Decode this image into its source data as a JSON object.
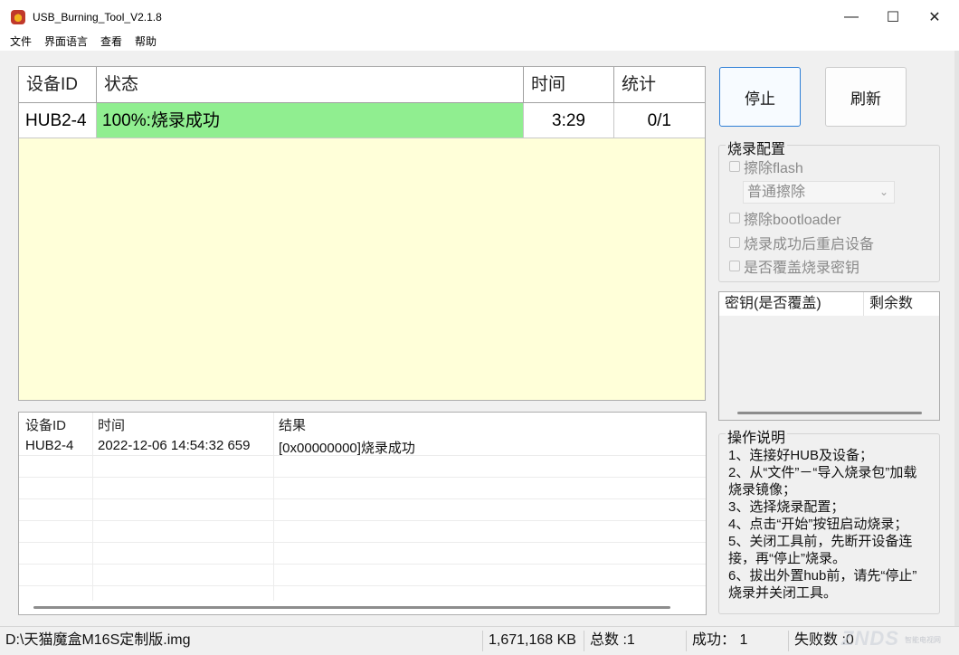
{
  "window": {
    "title": "USB_Burning_Tool_V2.1.8",
    "minimize_glyph": "—",
    "maximize_glyph": "☐",
    "close_glyph": "✕"
  },
  "menu": [
    "文件",
    "界面语言",
    "查看",
    "帮助"
  ],
  "device_table": {
    "headers": [
      "设备ID",
      "状态",
      "时间",
      "统计"
    ],
    "row": {
      "id": "HUB2-4",
      "status": "100%:烧录成功",
      "time": "3:29",
      "count": "0/1",
      "status_color": "#90ee90"
    },
    "background_color": "#ffffd9"
  },
  "buttons": {
    "stop": "停止",
    "refresh": "刷新"
  },
  "burn_config": {
    "title": "烧录配置",
    "erase_flash": "擦除flash",
    "erase_mode": "普通擦除",
    "erase_bootloader": "擦除bootloader",
    "reboot_after_success": "烧录成功后重启设备",
    "overwrite_key": "是否覆盖烧录密钥"
  },
  "key_list": {
    "headers": [
      "密钥(是否覆盖)",
      "剩余数"
    ]
  },
  "instructions": {
    "title": "操作说明",
    "lines": [
      "1、连接好HUB及设备；",
      "2、从“文件”－“导入烧录包”加载",
      "烧录镜像；",
      "3、选择烧录配置；",
      "4、点击“开始”按钮启动烧录；",
      "5、关闭工具前，先断开设备连",
      "接，再“停止”烧录。",
      "6、拔出外置hub前，请先“停止”",
      "烧录并关闭工具。"
    ]
  },
  "log_table": {
    "headers": [
      "设备ID",
      "时间",
      "结果"
    ],
    "rows": [
      {
        "id": "HUB2-4",
        "time": "2022-12-06 14:54:32 659",
        "result": "[0x00000000]烧录成功"
      }
    ]
  },
  "status_bar": {
    "image_path": "D:\\天猫魔盒M16S定制版.img",
    "size": "1,671,168 KB",
    "total": "总数 :1",
    "success": "成功： 1",
    "failed": "失败数 :0"
  },
  "watermark": {
    "text": "ZNDS",
    "sub": "智能电视网"
  },
  "icons": {
    "app": "app-logo-icon",
    "dropdown": "chevron-down-icon"
  }
}
